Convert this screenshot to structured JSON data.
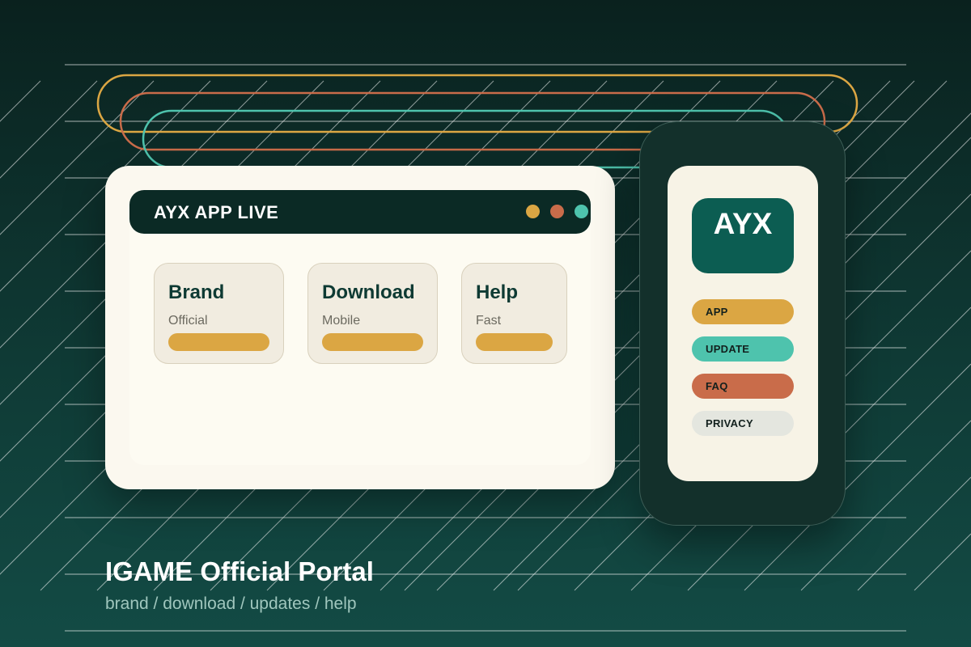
{
  "window": {
    "title": "AYX APP LIVE",
    "dots": [
      "#dba643",
      "#c96c4a",
      "#4ec3ad"
    ],
    "cards": [
      {
        "title": "Brand",
        "subtitle": "Official"
      },
      {
        "title": "Download",
        "subtitle": "Mobile"
      },
      {
        "title": "Help",
        "subtitle": "Fast"
      }
    ]
  },
  "phone": {
    "logo": "AYX",
    "menu": [
      {
        "label": "APP",
        "color": "#dba643"
      },
      {
        "label": "UPDATE",
        "color": "#4ec3ad"
      },
      {
        "label": "FAQ",
        "color": "#c96c4a"
      },
      {
        "label": "PRIVACY",
        "color": "#e4e6df"
      }
    ]
  },
  "footer": {
    "title": "IGAME Official Portal",
    "subtitle": "brand / download / updates / help"
  },
  "colors": {
    "accent_gold": "#dba643",
    "accent_teal": "#4ec3ad",
    "accent_orange": "#c96c4a",
    "dark_green": "#0b2a25"
  }
}
